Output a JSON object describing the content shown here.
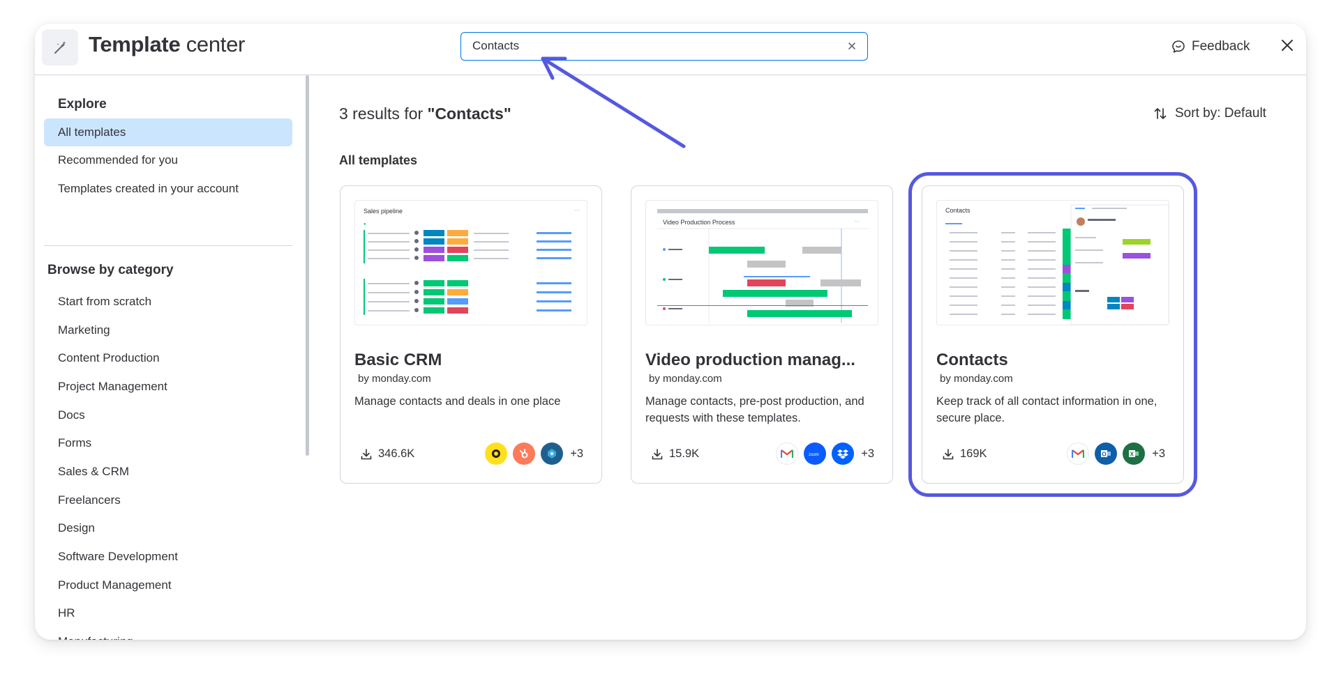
{
  "header": {
    "title_bold": "Template",
    "title_rest": " center",
    "search_value": "Contacts",
    "feedback_label": "Feedback"
  },
  "sidebar": {
    "explore_title": "Explore",
    "explore_items": [
      "All templates",
      "Recommended for you",
      "Templates created in your account"
    ],
    "category_title": "Browse by category",
    "categories": [
      "Start from scratch",
      "Marketing",
      "Content Production",
      "Project Management",
      "Docs",
      "Forms",
      "Sales & CRM",
      "Freelancers",
      "Design",
      "Software Development",
      "Product Management",
      "HR",
      "Manufacturing"
    ]
  },
  "main": {
    "results_prefix": "3 results for ",
    "results_query": "\"Contacts\"",
    "sort_label": "Sort by: Default",
    "section_title": "All templates",
    "cards": [
      {
        "title": "Basic CRM",
        "by": "by monday.com",
        "description": "Manage contacts and deals in one place",
        "downloads": "346.6K",
        "more_apps": "+3",
        "thumb_title": "Sales pipeline",
        "apps": [
          "mailchimp-icon",
          "hubspot-icon",
          "gem-icon"
        ]
      },
      {
        "title": "Video production manag...",
        "by": "by monday.com",
        "description": "Manage contacts, pre-post production, and requests with these templates.",
        "downloads": "15.9K",
        "more_apps": "+3",
        "thumb_title": "Video Production Process",
        "apps": [
          "gmail-icon",
          "zoom-icon",
          "dropbox-icon"
        ]
      },
      {
        "title": "Contacts",
        "by": "by monday.com",
        "description": "Keep track of all contact information in one, secure place.",
        "downloads": "169K",
        "more_apps": "+3",
        "thumb_title": "Contacts",
        "apps": [
          "gmail-icon",
          "outlook-icon",
          "excel-icon"
        ]
      }
    ]
  },
  "colors": {
    "accent": "#0073ea",
    "selected": "#cce5ff",
    "annotation": "#5559df"
  }
}
